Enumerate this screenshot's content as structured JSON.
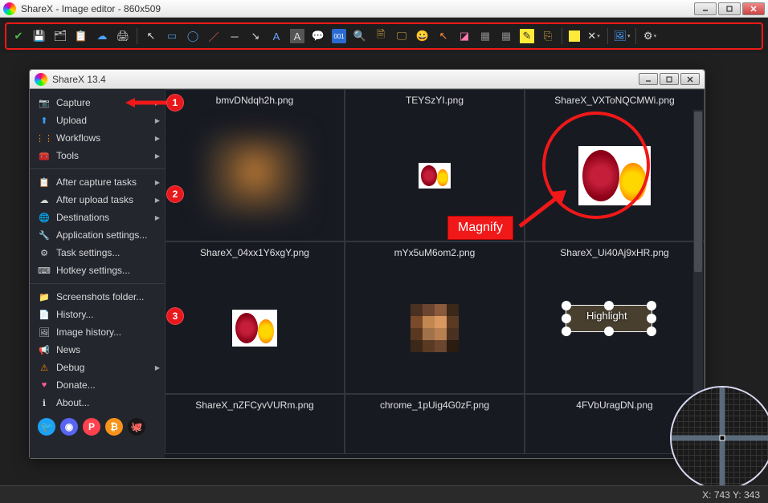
{
  "outer": {
    "title": "ShareX - Image editor - 860x509"
  },
  "inner": {
    "title": "ShareX 13.4"
  },
  "sidebar": {
    "items": [
      {
        "icon": "📷",
        "label": "Capture",
        "arrow": true
      },
      {
        "icon": "⬆",
        "label": "Upload",
        "arrow": true,
        "iconColor": "#3aa0ff"
      },
      {
        "icon": "◦",
        "label": "Workflows",
        "arrow": true,
        "iconColor": "#ff6a00"
      },
      {
        "icon": "🧰",
        "label": "Tools",
        "arrow": true
      }
    ],
    "items2": [
      {
        "icon": "📋",
        "label": "After capture tasks",
        "arrow": true,
        "iconColor": "#3aa0ff"
      },
      {
        "icon": "☁",
        "label": "After upload tasks",
        "arrow": true
      },
      {
        "icon": "🌐",
        "label": "Destinations",
        "arrow": true,
        "iconColor": "#3aa0ff"
      },
      {
        "icon": "🔧",
        "label": "Application settings..."
      },
      {
        "icon": "⚙",
        "label": "Task settings..."
      },
      {
        "icon": "⌨",
        "label": "Hotkey settings..."
      }
    ],
    "items3": [
      {
        "icon": "📁",
        "label": "Screenshots folder...",
        "iconColor": "#d8a040"
      },
      {
        "icon": "📄",
        "label": "History..."
      },
      {
        "icon": "🖼",
        "label": "Image history..."
      },
      {
        "icon": "📢",
        "label": "News",
        "iconColor": "#ff4a4a"
      },
      {
        "icon": "⚠",
        "label": "Debug",
        "arrow": true,
        "iconColor": "#ff8a00"
      },
      {
        "icon": "♥",
        "label": "Donate...",
        "iconColor": "#ff5aa0"
      },
      {
        "icon": "ℹ",
        "label": "About..."
      }
    ]
  },
  "thumbs": [
    {
      "title": "bmvDNdqh2h.png"
    },
    {
      "title": "TEYSzYI.png"
    },
    {
      "title": "ShareX_VXToNQCMWi.png"
    },
    {
      "title": "ShareX_04xx1Y6xgY.png"
    },
    {
      "title": "mYx5uM6om2.png"
    },
    {
      "title": "ShareX_Ui40Aj9xHR.png"
    },
    {
      "title": "ShareX_nZFCyvVURm.png"
    },
    {
      "title": "chrome_1pUig4G0zF.png"
    },
    {
      "title": "4FVbUragDN.png"
    }
  ],
  "annotations": {
    "magnify_label": "Magnify",
    "highlight_label": "Highlight",
    "step1": "1",
    "step2": "2",
    "step3": "3"
  },
  "status": {
    "coords": "X: 743 Y: 343"
  },
  "social": {
    "twitter": "t",
    "discord": "d",
    "patreon": "P",
    "bitcoin": "₿",
    "github": "g"
  }
}
